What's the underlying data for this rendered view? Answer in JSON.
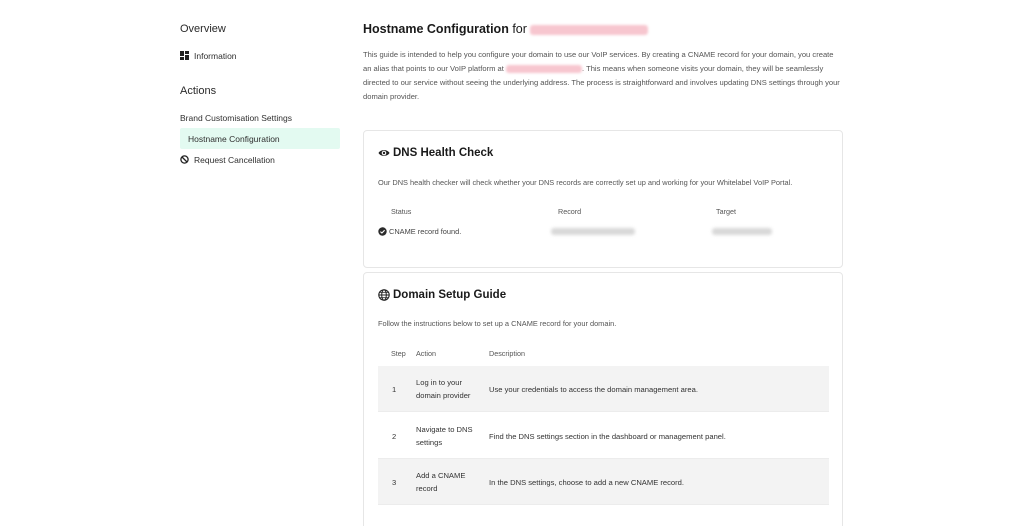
{
  "sidebar": {
    "overview_heading": "Overview",
    "overview_items": [
      {
        "label": "Information",
        "icon": "dashboard-icon"
      }
    ],
    "actions_heading": "Actions",
    "actions_items": [
      {
        "label": "Brand Customisation Settings"
      },
      {
        "label": "Hostname Configuration",
        "active": true
      },
      {
        "label": "Request Cancellation",
        "icon": "ban-icon"
      }
    ]
  },
  "main": {
    "title": "Hostname Configuration",
    "title_for": "for",
    "intro_part1": "This guide is intended to help you configure your domain to use our VoIP services. By creating a CNAME record for your domain, you create an alias that points to our VoIP platform at",
    "intro_part2": ". This means when someone visits your domain, they will be seamlessly directed to our service without seeing the underlying address. The process is straightforward and involves updating DNS settings through your domain provider."
  },
  "dns_check": {
    "title": "DNS Health Check",
    "icon": "eye-icon",
    "description": "Our DNS health checker will check whether your DNS records are correctly set up and working for your Whitelabel VoIP Portal.",
    "columns": [
      "Status",
      "Record",
      "Target"
    ],
    "row": {
      "status": "CNAME record found."
    }
  },
  "setup_guide": {
    "title": "Domain Setup Guide",
    "icon": "globe-icon",
    "description": "Follow the instructions below to set up a CNAME record for your domain.",
    "columns": [
      "Step",
      "Action",
      "Description"
    ],
    "steps": [
      {
        "step": "1",
        "action": "Log in to your domain provider",
        "description": "Use your credentials to access the domain management area."
      },
      {
        "step": "2",
        "action": "Navigate to DNS settings",
        "description": "Find the DNS settings section in the dashboard or management panel."
      },
      {
        "step": "3",
        "action": "Add a CNAME record",
        "description": "In the DNS settings, choose to add a new CNAME record."
      }
    ]
  },
  "colors": {
    "active_bg": "#e3faf1",
    "redacted_pink": "#f7c6cf",
    "row_shade": "#f3f3f3"
  }
}
